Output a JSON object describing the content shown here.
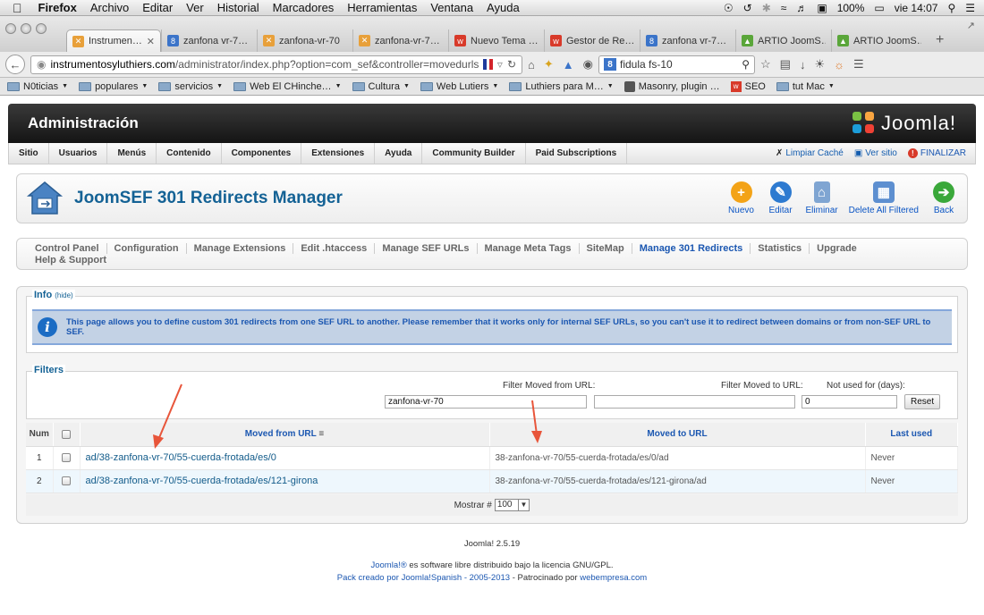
{
  "menubar": {
    "app": "Firefox",
    "items": [
      "Archivo",
      "Editar",
      "Ver",
      "Historial",
      "Marcadores",
      "Herramientas",
      "Ventana",
      "Ayuda"
    ],
    "battery": "100%",
    "clock": "vie 14:07"
  },
  "tabs": [
    {
      "label": "Instrumen…",
      "color": "#e8a03a",
      "glyph": "✕",
      "active": true
    },
    {
      "label": "zanfona vr-7…",
      "color": "#3b74c9",
      "glyph": "8"
    },
    {
      "label": "zanfona-vr-70",
      "color": "#e8a03a",
      "glyph": "✕"
    },
    {
      "label": "zanfona-vr-7…",
      "color": "#e8a03a",
      "glyph": "✕"
    },
    {
      "label": "Nuevo Tema …",
      "color": "#d83a2a",
      "glyph": "w"
    },
    {
      "label": "Gestor de Re…",
      "color": "#d83a2a",
      "glyph": "w"
    },
    {
      "label": "zanfona vr-7…",
      "color": "#3b74c9",
      "glyph": "8"
    },
    {
      "label": "ARTIO JoomS…",
      "color": "#5aa63a",
      "glyph": "▲"
    },
    {
      "label": "ARTIO JoomS…",
      "color": "#5aa63a",
      "glyph": "▲"
    }
  ],
  "url": {
    "host": "instrumentosyluthiers.com",
    "path": "/administrator/index.php?option=com_sef&controller=movedurls"
  },
  "search": {
    "value": "fidula fs-10"
  },
  "bookmarks": [
    "N0ticias",
    "populares",
    "servicios",
    "Web El CHinche…",
    "Cultura",
    "Web Lutiers",
    "Luthiers para M…",
    "Masonry, plugin …",
    "SEO",
    "tut Mac"
  ],
  "admin": {
    "title": "Administración",
    "logo": "Joomla!"
  },
  "mainmenu": {
    "items": [
      "Sitio",
      "Usuarios",
      "Menús",
      "Contenido",
      "Componentes",
      "Extensiones",
      "Ayuda",
      "Community Builder",
      "Paid Subscriptions"
    ],
    "clear_cache": "Limpiar Caché",
    "view_site": "Ver sitio",
    "logout": "FINALIZAR"
  },
  "toolbar": {
    "title": "JoomSEF 301 Redirects Manager",
    "new": "Nuevo",
    "edit": "Editar",
    "delete": "Eliminar",
    "delete_all": "Delete All Filtered",
    "back": "Back"
  },
  "submenu": {
    "items": [
      "Control Panel",
      "Configuration",
      "Manage Extensions",
      "Edit .htaccess",
      "Manage SEF URLs",
      "Manage Meta Tags",
      "SiteMap",
      "Manage 301 Redirects",
      "Statistics",
      "Upgrade"
    ],
    "active": "Manage 301 Redirects",
    "second_row": "Help & Support"
  },
  "info": {
    "legend": "Info",
    "hide": "(hide)",
    "text": "This page allows you to define custom 301 redirects from one SEF URL to another. Please remember that it works only for internal SEF URLs, so you can't use it to redirect between domains or from non-SEF URL to SEF."
  },
  "filters": {
    "legend": "Filters",
    "from_label": "Filter Moved from URL:",
    "from_value": "zanfona-vr-70",
    "to_label": "Filter Moved to URL:",
    "to_value": "",
    "days_label": "Not used for (days):",
    "days_value": "0",
    "reset": "Reset"
  },
  "table": {
    "headers": {
      "num": "Num",
      "from": "Moved from URL",
      "to": "Moved to URL",
      "last": "Last used"
    },
    "rows": [
      {
        "num": "1",
        "from": "ad/38-zanfona-vr-70/55-cuerda-frotada/es/0",
        "to": "38-zanfona-vr-70/55-cuerda-frotada/es/0/ad",
        "last": "Never"
      },
      {
        "num": "2",
        "from": "ad/38-zanfona-vr-70/55-cuerda-frotada/es/121-girona",
        "to": "38-zanfona-vr-70/55-cuerda-frotada/es/121-girona/ad",
        "last": "Never"
      }
    ],
    "show_label": "Mostrar #",
    "show_value": "100"
  },
  "footer": {
    "version": "Joomla! 2.5.19",
    "line1_link": "Joomla!®",
    "line1_text": " es software libre distribuido bajo la licencia GNU/GPL.",
    "line2_link1": "Pack creado por Joomla!Spanish - 2005-2013",
    "line2_text": " - Patrocinado por ",
    "line2_link2": "webempresa.com"
  },
  "colors": {
    "accent": "#146295",
    "link": "#1b57b1",
    "arrow": "#e8553a"
  }
}
